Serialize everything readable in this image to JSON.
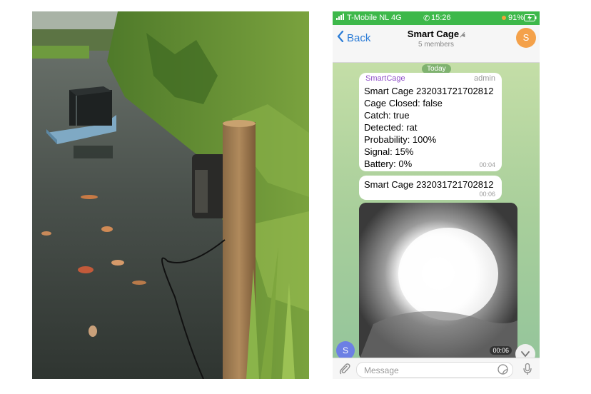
{
  "status_bar": {
    "carrier": "T-Mobile NL",
    "network": "4G",
    "time": "15:26",
    "battery": "91%",
    "signal_icon": "signal-bars-icon",
    "call_icon": "phone-icon",
    "battery_icon": "battery-charging-icon"
  },
  "header": {
    "back_label": "Back",
    "title": "Smart Cage",
    "mute_icon": "muted-icon",
    "subtitle": "5 members",
    "avatar_letter": "S",
    "avatar_color": "#f4a14a"
  },
  "chat": {
    "date_label": "Today",
    "messages": [
      {
        "sender": "SmartCage",
        "role": "admin",
        "lines": [
          "Smart Cage 232031721702812",
          "Cage Closed: false",
          "Catch: true",
          "Detected: rat",
          "Probability: 100%",
          "Signal: 15%",
          "Battery: 0%"
        ],
        "time": "00:04"
      },
      {
        "text": "Smart Cage 232031721702812",
        "time": "00:06"
      },
      {
        "type": "video",
        "duration": "00:06"
      }
    ],
    "sender_avatar_letter": "S",
    "sender_avatar_color": "#6c7fe4"
  },
  "input": {
    "placeholder": "Message",
    "attach_icon": "paperclip-icon",
    "sticker_icon": "sticker-icon",
    "mic_icon": "microphone-icon",
    "scroll_icon": "chevron-down-icon"
  },
  "colors": {
    "status_bar": "#3db84a",
    "accent": "#2a7bd6",
    "sender_name": "#9050c8",
    "chat_background": "#b9d9a6"
  }
}
